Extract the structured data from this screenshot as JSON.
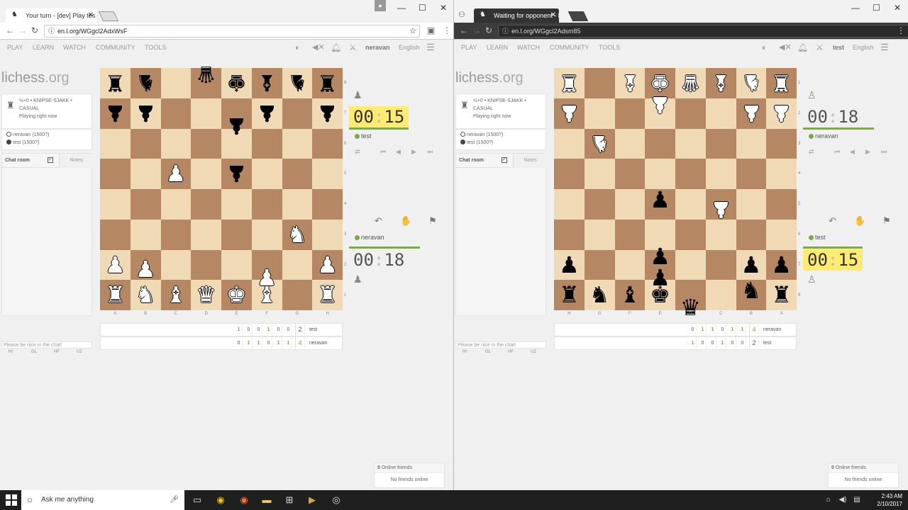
{
  "left": {
    "tab_title": "Your turn - [dev] Play tes",
    "url": "en.l.org/WGgcl2AdxWsF",
    "nav": [
      "PLAY",
      "LEARN",
      "WATCH",
      "COMMUNITY",
      "TOOLS"
    ],
    "username": "neravan",
    "language": "English",
    "logo_main": "lichess",
    "logo_tld": ".org",
    "game_info": {
      "line1": "½+0 • KNIPSE-SJAKK •",
      "line2": "CASUAL",
      "line3": "Playing right now"
    },
    "players": [
      "neravan (1500?)",
      "test (1500?)"
    ],
    "chat": {
      "title": "Chat room",
      "notes": "Notes",
      "placeholder": "Please be nice in the chat!",
      "buttons": [
        "HI",
        "GL",
        "HF",
        "U2"
      ]
    },
    "files": [
      "A",
      "B",
      "C",
      "D",
      "E",
      "F",
      "G",
      "H"
    ],
    "ranks": [
      "8",
      "7",
      "6",
      "5",
      "4",
      "3",
      "2",
      "1"
    ],
    "top_clock": {
      "mm": "00",
      "ss": "15",
      "name": "test"
    },
    "bottom_clock": {
      "mm": "00",
      "ss": "18",
      "name": "neravan"
    },
    "move_rows": [
      {
        "cells": [
          "1",
          "0",
          "0",
          "1",
          "0",
          "0"
        ],
        "score": "2",
        "name": "test"
      },
      {
        "cells": [
          "0",
          "1",
          "1",
          "0",
          "1",
          "1"
        ],
        "score": "4",
        "name": "neravan"
      }
    ],
    "friends": {
      "count": "0",
      "label": " Online friends",
      "empty": "No friends online"
    }
  },
  "right": {
    "tab_title": "Waiting for opponent - l",
    "url": "en.l.org/WGgcl2Adsm85",
    "nav": [
      "PLAY",
      "LEARN",
      "WATCH",
      "COMMUNITY",
      "TOOLS"
    ],
    "username": "test",
    "language": "English",
    "logo_main": "lichess",
    "logo_tld": ".org",
    "game_info": {
      "line1": "½+0 • KNIPSE-SJAKK •",
      "line2": "CASUAL",
      "line3": "Playing right now"
    },
    "players": [
      "neravan (1500?)",
      "test (1500?)"
    ],
    "chat": {
      "title": "Chat room",
      "notes": "Notes",
      "placeholder": "Please be nice in the chat!",
      "buttons": [
        "HI",
        "GL",
        "HF",
        "U2"
      ]
    },
    "files": [
      "H",
      "G",
      "F",
      "E",
      "D",
      "C",
      "B",
      "A"
    ],
    "ranks": [
      "1",
      "2",
      "3",
      "4",
      "5",
      "6",
      "7",
      "8"
    ],
    "top_clock": {
      "mm": "00",
      "ss": "18",
      "name": "neravan"
    },
    "bottom_clock": {
      "mm": "00",
      "ss": "15",
      "name": "test"
    },
    "move_rows": [
      {
        "cells": [
          "0",
          "1",
          "1",
          "0",
          "1",
          "1"
        ],
        "score": "4",
        "name": "neravan"
      },
      {
        "cells": [
          "1",
          "0",
          "0",
          "1",
          "0",
          "0"
        ],
        "score": "2",
        "name": "test"
      }
    ],
    "friends": {
      "count": "0",
      "label": " Online friends",
      "empty": "No friends online"
    }
  },
  "taskbar": {
    "search": "Ask me anything",
    "time": "2:43 AM",
    "date": "2/10/2017"
  },
  "colors": {
    "light_square": "#f0d9b5",
    "dark_square": "#b58863",
    "clock_active": "#ffeb70",
    "green": "#7fa650"
  }
}
